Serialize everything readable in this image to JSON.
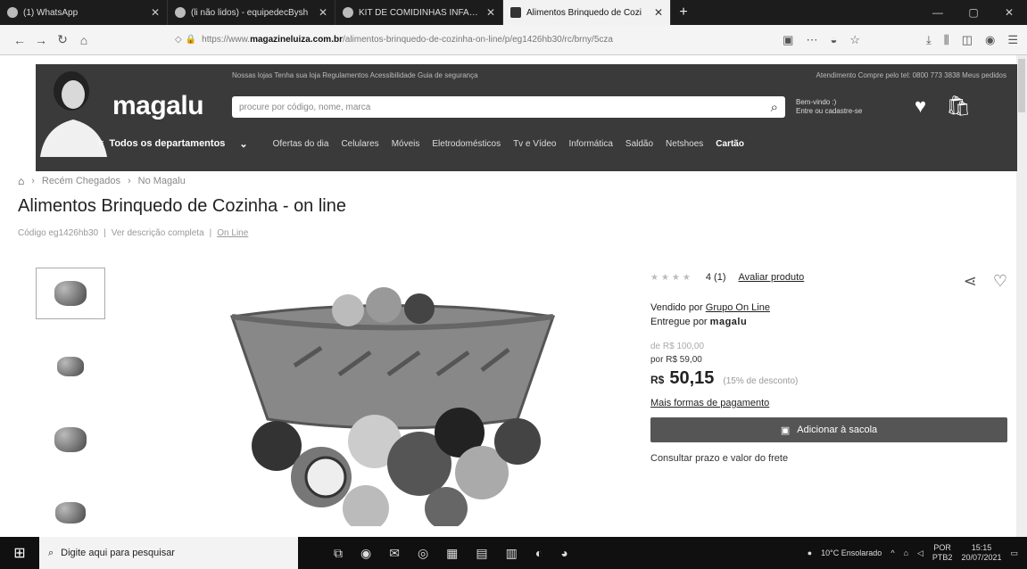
{
  "browser": {
    "tabs": [
      {
        "title": "(1) WhatsApp",
        "active": false
      },
      {
        "title": "(li não lidos) - equipedecBysh",
        "active": false
      },
      {
        "title": "KIT DE COMIDINHAS INFANTI",
        "active": false
      },
      {
        "title": "Alimentos Brinquedo de Cozi",
        "active": true
      }
    ],
    "url_prefix": "https://www.",
    "url_domain": "magazineluiza.com.br",
    "url_path": "/alimentos-brinquedo-de-cozinha-on-line/p/eg1426hb30/rc/brny/5cza"
  },
  "header": {
    "logo": "magalu",
    "top_links": "Nossas lojas  Tenha sua loja  Regulamentos  Acessibilidade  Guia de segurança",
    "top_right": "Atendimento  Compre pelo tel: 0800 773 3838  Meus pedidos",
    "search_placeholder": "procure por código, nome, marca",
    "welcome_line1": "Bem-vindo :)",
    "welcome_line2": "Entre ou cadastre-se",
    "departments_label": "Todos os departamentos",
    "menu": [
      "Ofertas do dia",
      "Celulares",
      "Móveis",
      "Eletrodomésticos",
      "Tv e Vídeo",
      "Informática",
      "Saldão",
      "Netshoes",
      "Cartão"
    ]
  },
  "breadcrumb": [
    "Recém Chegados",
    "No Magalu"
  ],
  "product": {
    "title": "Alimentos Brinquedo de Cozinha - on line",
    "code": "Código eg1426hb30",
    "desc_link": "Ver descrição completa",
    "brand_link": "On Line",
    "rating_text": "4 (1)",
    "rating_link": "Avaliar produto",
    "rating_value": 4,
    "sold_by_label": "Vendido por",
    "sold_by": "Grupo On Line",
    "delivered_by_label": "Entregue por",
    "delivered_by": "magalu",
    "price_old": "de R$ 100,00",
    "price_por": "por R$ 59,00",
    "price_currency": "R$",
    "price_value": "50,15",
    "price_discount": "(15% de desconto)",
    "more_payment": "Mais formas de pagamento",
    "add_button": "Adicionar à sacola",
    "shipping": "Consultar prazo e valor do frete"
  },
  "taskbar": {
    "search_placeholder": "Digite aqui para pesquisar",
    "weather": "10°C  Ensolarado",
    "lang1": "POR",
    "lang2": "PTB2",
    "time": "15:15",
    "date": "20/07/2021"
  }
}
